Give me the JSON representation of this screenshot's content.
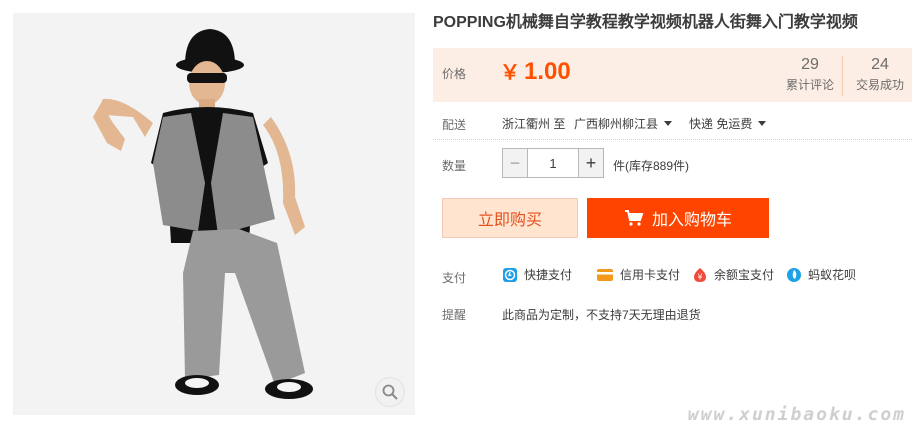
{
  "product": {
    "title": "POPPING机械舞自学教程教学视频机器人街舞入门教学视频"
  },
  "price": {
    "label": "价格",
    "currency": "￥",
    "value": "1.00",
    "color": "#ff5000"
  },
  "stats": {
    "reviews_count": "29",
    "reviews_label": "累计评论",
    "deals_count": "24",
    "deals_label": "交易成功"
  },
  "delivery": {
    "label": "配送",
    "from": "浙江衢州 至",
    "to": "广西柳州柳江县",
    "method": "快递 免运费"
  },
  "quantity": {
    "label": "数量",
    "value": "1",
    "stock_text": "件(库存889件)"
  },
  "buttons": {
    "buy_now": "立即购买",
    "add_to_cart": "加入购物车"
  },
  "payment": {
    "label": "支付",
    "methods": [
      "快捷支付",
      "信用卡支付",
      "余额宝支付",
      "蚂蚁花呗"
    ]
  },
  "reminder": {
    "label": "提醒",
    "text": "此商品为定制，不支持7天无理由退货"
  },
  "watermark": "www.xunibaoku.com",
  "icons": {
    "zoom": "magnifier-icon",
    "cart": "cart-icon",
    "quick_pay": "quick-pay-icon",
    "credit_card": "credit-card-icon",
    "yuebao": "yuebao-icon",
    "huabei": "huabei-icon"
  }
}
